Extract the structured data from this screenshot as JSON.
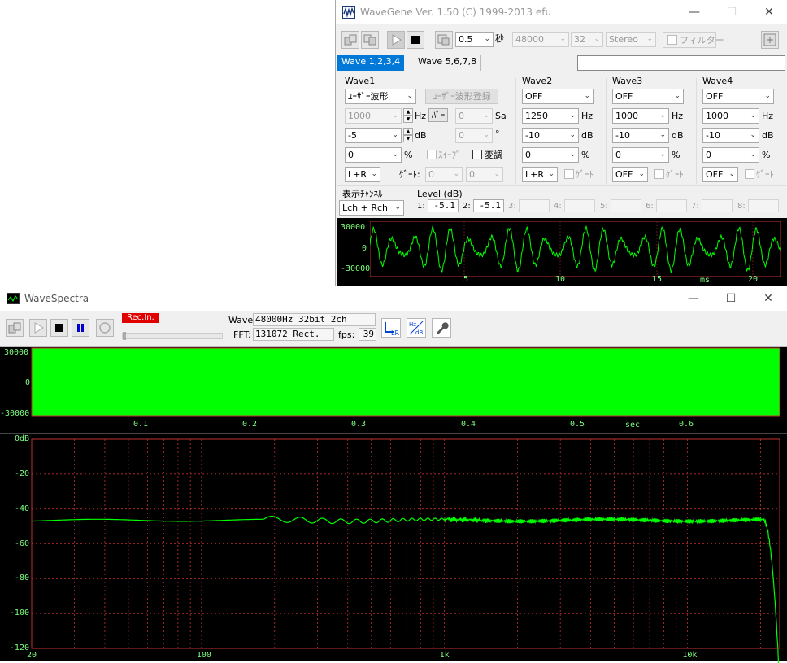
{
  "wavegene": {
    "title": "WaveGene  Ver. 1.50  (C) 1999-2013 efu",
    "toolbar": {
      "duration_value": "0.5",
      "duration_unit": "秒",
      "samplerate": "48000",
      "bits": "32",
      "channels": "Stereo",
      "filter_label": "フィルター"
    },
    "tabs": [
      "Wave 1,2,3,4",
      "Wave 5,6,7,8"
    ],
    "wave1": {
      "title": "Wave1",
      "type": "ﾕｰｻﾞｰ波形",
      "register_button": "ﾕｰｻﾞｰ波形登録",
      "freq": "1000",
      "freq_unit": "Hz",
      "param_button": "ﾊﾟｰ",
      "sa_value": "0",
      "sa_unit": "Sa",
      "level": "-5",
      "level_unit": "dB",
      "phase": "0",
      "phase_unit": "°",
      "offset": "0",
      "offset_unit": "%",
      "sweep_label": "ｽｲｰﾌﾟ",
      "mod_label": "変調",
      "channel": "L+R",
      "gate_label": "ｹﾞｰﾄ:",
      "gate1": "0",
      "gate2": "0"
    },
    "waves": [
      {
        "title": "Wave2",
        "type": "OFF",
        "freq": "1250",
        "level": "-10",
        "offset": "0",
        "channel": "L+R"
      },
      {
        "title": "Wave3",
        "type": "OFF",
        "freq": "1000",
        "level": "-10",
        "offset": "0",
        "channel": "OFF"
      },
      {
        "title": "Wave4",
        "type": "OFF",
        "freq": "1000",
        "level": "-10",
        "offset": "0",
        "channel": "OFF"
      }
    ],
    "units": {
      "hz": "Hz",
      "db": "dB",
      "pct": "%",
      "gate": "ｹﾞｰﾄ"
    },
    "display_channel": {
      "label": "表示ﾁｬﾝﾈﾙ",
      "value": "Lch + Rch"
    },
    "level_db": {
      "label": "Level (dB)",
      "items": [
        {
          "n": "1:",
          "v": "-5.1"
        },
        {
          "n": "2:",
          "v": "-5.1"
        },
        {
          "n": "3:",
          "v": ""
        },
        {
          "n": "4:",
          "v": ""
        },
        {
          "n": "5:",
          "v": ""
        },
        {
          "n": "6:",
          "v": ""
        },
        {
          "n": "7:",
          "v": ""
        },
        {
          "n": "8:",
          "v": ""
        }
      ]
    },
    "scope": {
      "y_labels": [
        "30000",
        "0",
        "-30000"
      ],
      "x_labels": [
        "5",
        "10",
        "15",
        "ms",
        "20"
      ],
      "color": "#00ff00"
    }
  },
  "wavespectra": {
    "title": "WaveSpectra",
    "rec_label": "Rec.In.",
    "wave_label": "Wave:",
    "wave_value": "48000Hz 32bit 2ch",
    "fft_label": "FFT:",
    "fft_value": "131072 Rect.",
    "fps_label": "fps:",
    "fps_value": "39",
    "lr_icon": "LR",
    "hzdb_icon_top": "Hz",
    "hzdb_icon_bottom": "dB",
    "timeline": {
      "y_labels": [
        "30000",
        "0",
        "-30000"
      ],
      "x_labels": [
        "0.1",
        "0.2",
        "0.3",
        "0.4",
        "0.5",
        "sec",
        "0.6"
      ]
    },
    "spectrum": {
      "y_labels": [
        "0dB",
        "-20",
        "-40",
        "-60",
        "-80",
        "-100",
        "-120"
      ],
      "x_labels": [
        "20",
        "100",
        "1k",
        "10k"
      ],
      "grid_color": "#c03030",
      "trace_color": "#00ff00"
    }
  }
}
